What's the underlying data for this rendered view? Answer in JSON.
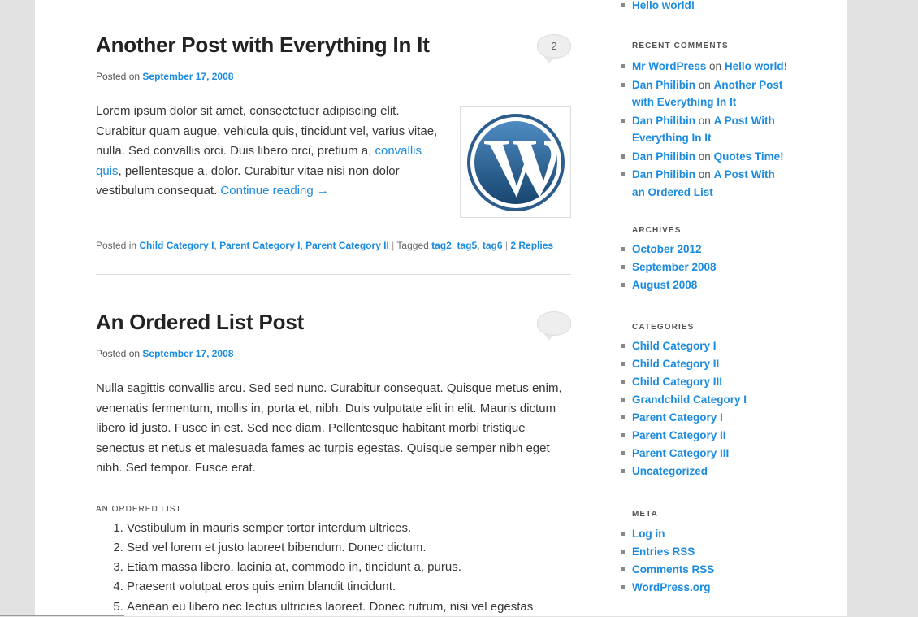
{
  "posts": [
    {
      "title": "Another Post with Everything In It",
      "comment_count": "2",
      "posted_on_label": "Posted on",
      "date": "September 17, 2008",
      "body_before_link": "Lorem ipsum dolor sit amet, consectetuer adipiscing elit. Curabitur quam augue, vehicula quis, tincidunt vel, varius vitae, nulla. Sed convallis orci. Duis libero orci, pretium a, ",
      "inline_link": "convallis quis",
      "body_after_link": ", pellentesque a, dolor. Curabitur vitae nisi non dolor vestibulum consequat. ",
      "continue_link": "Continue reading →",
      "posted_in_label": "Posted in",
      "categories": [
        "Child Category I",
        "Parent Category I",
        "Parent Category II"
      ],
      "tagged_label": "Tagged",
      "tags": [
        "tag2",
        "tag5",
        "tag6"
      ],
      "replies": "2 Replies"
    },
    {
      "title": "An Ordered List Post",
      "comment_count": "",
      "posted_on_label": "Posted on",
      "date": "September 17, 2008",
      "body": "Nulla sagittis convallis arcu. Sed sed nunc. Curabitur consequat. Quisque metus enim, venenatis fermentum, mollis in, porta et, nibh. Duis vulputate elit in elit. Mauris dictum libero id justo. Fusce in est. Sed nec diam. Pellentesque habitant morbi tristique senectus et netus et malesuada fames ac turpis egestas. Quisque semper nibh eget nibh. Sed tempor. Fusce erat.",
      "list_heading": "AN ORDERED LIST",
      "list_items": [
        "Vestibulum in mauris semper tortor interdum ultrices.",
        "Sed vel lorem et justo laoreet bibendum. Donec dictum.",
        "Etiam massa libero, lacinia at, commodo in, tincidunt a, purus.",
        "Praesent volutpat eros quis enim blandit tincidunt.",
        "Aenean eu libero nec lectus ultricies laoreet. Donec rutrum, nisi vel egestas"
      ]
    }
  ],
  "sidebar": {
    "top_item": "Hello world!",
    "recent_comments": {
      "title": "RECENT COMMENTS",
      "on_label": "on",
      "items": [
        {
          "author": "Mr WordPress",
          "post_line1": "Hello world!",
          "post_line2": ""
        },
        {
          "author": "Dan Philibin",
          "post_line1": "Another Post",
          "post_line2": "with Everything In It"
        },
        {
          "author": "Dan Philibin",
          "post_line1": "A Post With",
          "post_line2": "Everything In It"
        },
        {
          "author": "Dan Philibin",
          "post_line1": "Quotes Time!",
          "post_line2": ""
        },
        {
          "author": "Dan Philibin",
          "post_line1": "A Post With",
          "post_line2": "an Ordered List"
        }
      ]
    },
    "archives": {
      "title": "ARCHIVES",
      "items": [
        "October 2012",
        "September 2008",
        "August 2008"
      ]
    },
    "categories": {
      "title": "CATEGORIES",
      "items": [
        "Child Category I",
        "Child Category II",
        "Child Category III",
        "Grandchild Category I",
        "Parent Category I",
        "Parent Category II",
        "Parent Category III",
        "Uncategorized"
      ]
    },
    "meta": {
      "title": "META",
      "log_in": "Log in",
      "entries_rss_prefix": "Entries",
      "comments_rss_prefix": "Comments",
      "rss": "RSS",
      "wordpress_org": "WordPress.org"
    }
  },
  "colors": {
    "link": "#1b8be0",
    "page_bg": "#ffffff",
    "outer_bg": "#e2e2e2",
    "wp_logo_blue": "#21759b"
  },
  "icons": [
    "comment-bubble-icon",
    "wordpress-logo-icon",
    "list-bullet-icon"
  ]
}
